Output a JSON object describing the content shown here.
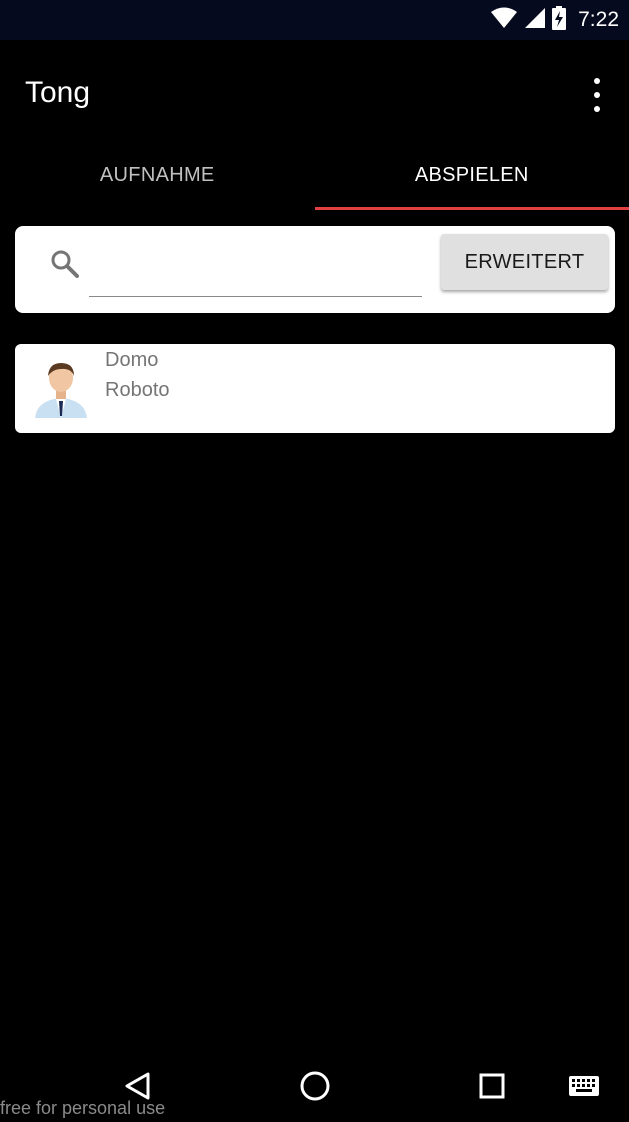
{
  "status_bar": {
    "time": "7:22",
    "icons": [
      "wifi-icon",
      "cell-signal-icon",
      "battery-charging-icon"
    ]
  },
  "app_bar": {
    "title": "Tong",
    "menu_icon": "more-vert-icon"
  },
  "tabs": [
    {
      "label": "AUFNAHME",
      "active": false
    },
    {
      "label": "ABSPIELEN",
      "active": true
    }
  ],
  "colors": {
    "tab_indicator": "#e14141",
    "status_bar_bg": "#060a1e",
    "background": "#000000",
    "card_bg": "#ffffff",
    "button_bg": "#e0e0e0"
  },
  "search": {
    "icon": "search-icon",
    "value": "",
    "advanced_button_label": "ERWEITERT"
  },
  "list": {
    "items": [
      {
        "line1": "Domo",
        "line2": "Roboto",
        "avatar": "person-avatar"
      }
    ]
  },
  "nav_bar": {
    "buttons": [
      "back-icon",
      "home-icon",
      "recents-icon",
      "keyboard-icon"
    ]
  },
  "watermark": "free for personal use"
}
